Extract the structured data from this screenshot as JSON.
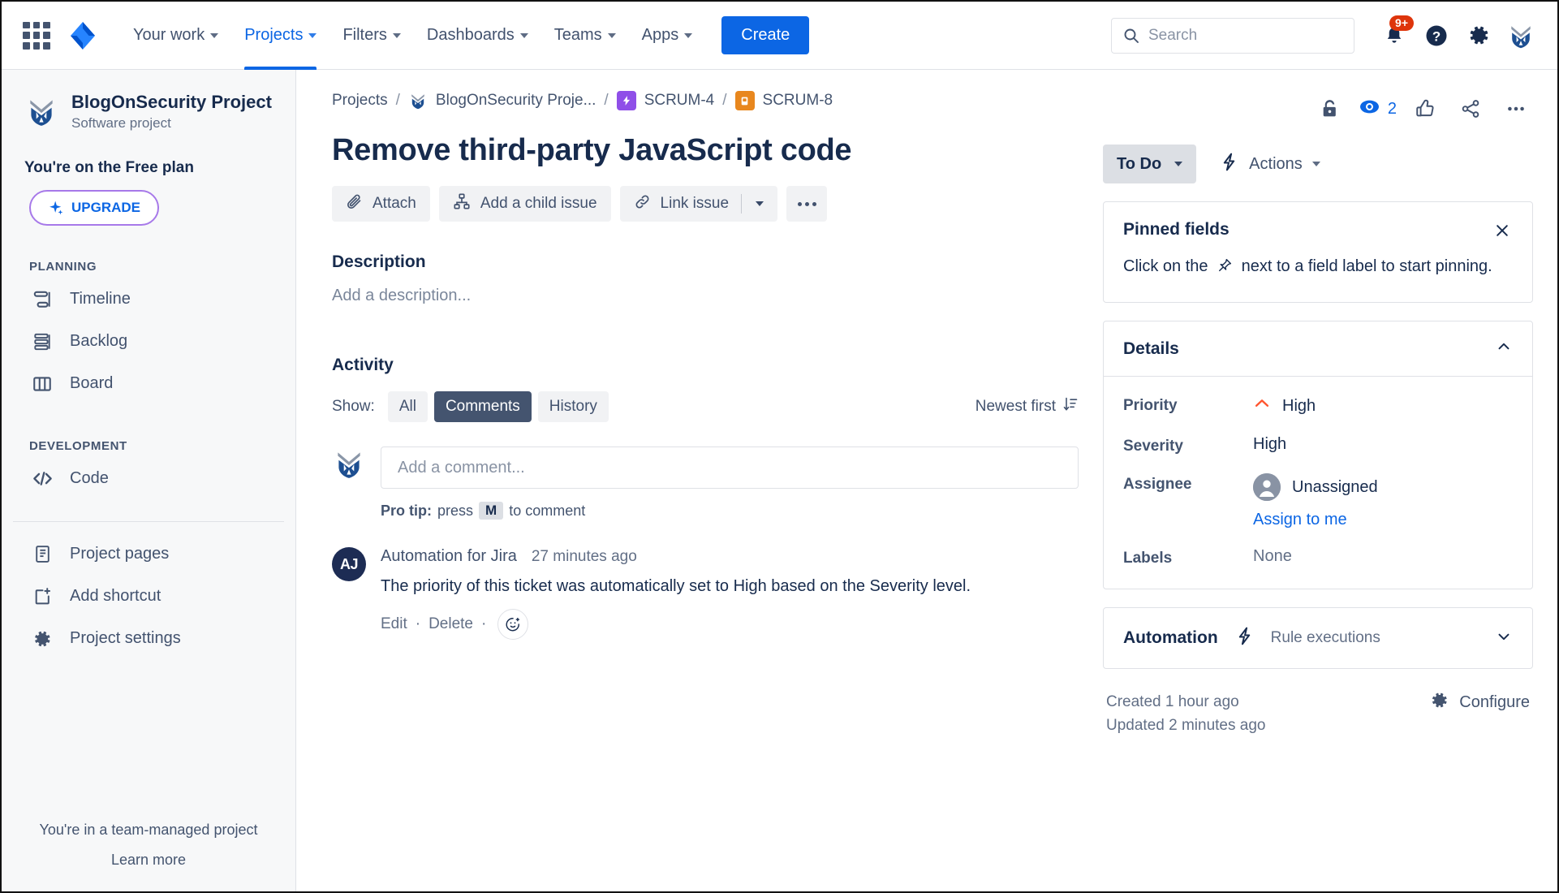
{
  "topnav": {
    "apps_grid": "app-switcher",
    "logo": "jira-logo",
    "items": [
      {
        "label": "Your work",
        "active": false
      },
      {
        "label": "Projects",
        "active": true
      },
      {
        "label": "Filters",
        "active": false
      },
      {
        "label": "Dashboards",
        "active": false
      },
      {
        "label": "Teams",
        "active": false
      },
      {
        "label": "Apps",
        "active": false
      }
    ],
    "create_label": "Create",
    "search_placeholder": "Search",
    "notification_badge": "9+",
    "icons": [
      "notifications-bell-icon",
      "help-icon",
      "settings-gear-icon",
      "user-avatar"
    ]
  },
  "sidebar": {
    "project_name": "BlogOnSecurity Project",
    "project_type": "Software project",
    "plan_text": "You're on the Free plan",
    "upgrade_label": "UPGRADE",
    "sections": [
      {
        "label": "PLANNING",
        "items": [
          {
            "label": "Timeline",
            "icon": "timeline-icon"
          },
          {
            "label": "Backlog",
            "icon": "backlog-icon"
          },
          {
            "label": "Board",
            "icon": "board-icon"
          }
        ]
      },
      {
        "label": "DEVELOPMENT",
        "items": [
          {
            "label": "Code",
            "icon": "code-icon"
          }
        ]
      }
    ],
    "extra_items": [
      {
        "label": "Project pages",
        "icon": "pages-icon"
      },
      {
        "label": "Add shortcut",
        "icon": "add-shortcut-icon"
      },
      {
        "label": "Project settings",
        "icon": "settings-gear-icon"
      }
    ],
    "footer_line1": "You're in a team-managed project",
    "footer_line2": "Learn more"
  },
  "breadcrumb": {
    "projects": "Projects",
    "project": "BlogOnSecurity Proje...",
    "epic": "SCRUM-4",
    "issue": "SCRUM-8",
    "sep": "/",
    "epic_color": "#8f4fe8",
    "issue_color": "#e8871e"
  },
  "issue": {
    "title": "Remove third-party JavaScript code",
    "actions": [
      {
        "label": "Attach",
        "icon": "paperclip-icon"
      },
      {
        "label": "Add a child issue",
        "icon": "child-issue-icon"
      },
      {
        "label": "Link issue",
        "icon": "link-icon"
      }
    ],
    "more_label": "more-actions"
  },
  "description": {
    "heading": "Description",
    "placeholder": "Add a description..."
  },
  "activity": {
    "heading": "Activity",
    "show_label": "Show:",
    "tabs": [
      {
        "label": "All",
        "selected": false
      },
      {
        "label": "Comments",
        "selected": true
      },
      {
        "label": "History",
        "selected": false
      }
    ],
    "sort_label": "Newest first",
    "comment_placeholder": "Add a comment...",
    "protip_prefix": "Pro tip:",
    "protip_press": "press",
    "protip_key": "M",
    "protip_suffix": "to comment",
    "comments": [
      {
        "avatar_initials": "AJ",
        "author": "Automation for Jira",
        "time": "27 minutes ago",
        "body": "The priority of this ticket was automatically set to High based on the Severity level.",
        "edit_label": "Edit",
        "delete_label": "Delete",
        "sep": "·"
      }
    ]
  },
  "right": {
    "status_label": "To Do",
    "actions_label": "Actions",
    "watch_count": "2",
    "header_icons": [
      "lock-open-icon",
      "watch-eye-icon",
      "thumbs-up-icon",
      "share-icon",
      "more-options-icon"
    ],
    "pinned": {
      "title": "Pinned fields",
      "text_before": "Click on the",
      "text_after": "next to a field label to start pinning.",
      "close": "close-icon"
    },
    "details": {
      "title": "Details",
      "fields": [
        {
          "label": "Priority",
          "value": "High",
          "icon": "priority-high-icon"
        },
        {
          "label": "Severity",
          "value": "High",
          "icon": ""
        },
        {
          "label": "Assignee",
          "value": "Unassigned",
          "icon": "user-avatar-icon",
          "link": "Assign to me"
        },
        {
          "label": "Labels",
          "value": "None",
          "icon": ""
        }
      ]
    },
    "automation": {
      "title": "Automation",
      "rule_label": "Rule executions",
      "icon": "automation-bolt-icon"
    },
    "created": "Created 1 hour ago",
    "updated": "Updated 2 minutes ago",
    "configure_label": "Configure"
  },
  "colors": {
    "brand_blue": "#0c66e4",
    "priority_high": "#ff5630",
    "epic_purple": "#8f4fe8",
    "story_orange": "#e8871e",
    "badge_red": "#de350b",
    "selected_pill": "#44546f"
  }
}
